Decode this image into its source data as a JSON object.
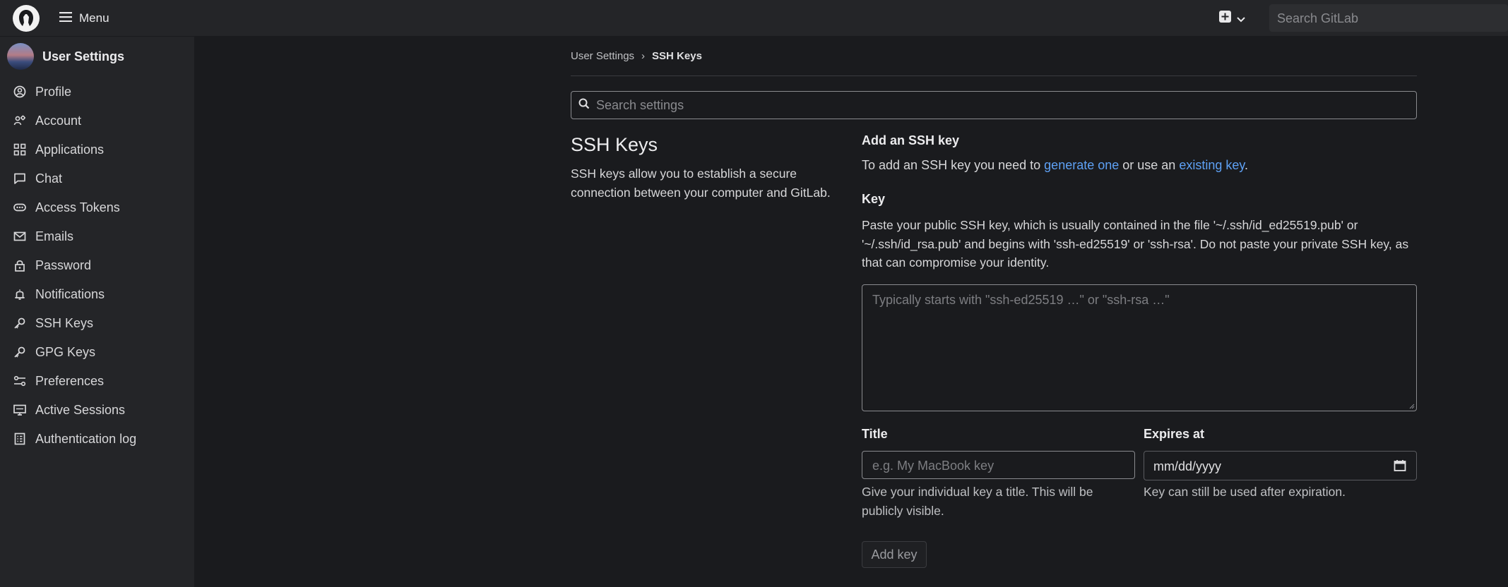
{
  "topbar": {
    "menu_label": "Menu",
    "search_placeholder": "Search GitLab"
  },
  "sidebar": {
    "title": "User Settings",
    "items": [
      {
        "label": "Profile",
        "icon": "profile-icon"
      },
      {
        "label": "Account",
        "icon": "account-icon"
      },
      {
        "label": "Applications",
        "icon": "applications-icon"
      },
      {
        "label": "Chat",
        "icon": "chat-icon"
      },
      {
        "label": "Access Tokens",
        "icon": "token-icon"
      },
      {
        "label": "Emails",
        "icon": "mail-icon"
      },
      {
        "label": "Password",
        "icon": "lock-icon"
      },
      {
        "label": "Notifications",
        "icon": "bell-icon"
      },
      {
        "label": "SSH Keys",
        "icon": "key-icon"
      },
      {
        "label": "GPG Keys",
        "icon": "key-icon"
      },
      {
        "label": "Preferences",
        "icon": "preferences-icon"
      },
      {
        "label": "Active Sessions",
        "icon": "monitor-icon"
      },
      {
        "label": "Authentication log",
        "icon": "log-icon"
      }
    ]
  },
  "breadcrumb": {
    "parent": "User Settings",
    "separator": "›",
    "current": "SSH Keys"
  },
  "settings_search": {
    "placeholder": "Search settings"
  },
  "section": {
    "title": "SSH Keys",
    "description": "SSH keys allow you to establish a secure connection between your computer and GitLab."
  },
  "form": {
    "add_title": "Add an SSH key",
    "add_help_prefix": "To add an SSH key you need to ",
    "generate_link": "generate one",
    "add_help_middle": " or use an ",
    "existing_link": "existing key",
    "add_help_suffix": ".",
    "key_label": "Key",
    "key_help": "Paste your public SSH key, which is usually contained in the file '~/.ssh/id_ed25519.pub' or '~/.ssh/id_rsa.pub' and begins with 'ssh-ed25519' or 'ssh-rsa'. Do not paste your private SSH key, as that can compromise your identity.",
    "key_placeholder": "Typically starts with \"ssh-ed25519 …\" or \"ssh-rsa …\"",
    "title_label": "Title",
    "title_placeholder": "e.g. My MacBook key",
    "title_help": "Give your individual key a title. This will be publicly visible.",
    "expires_label": "Expires at",
    "expires_value": "mm/dd/yyyy",
    "expires_help": "Key can still be used after expiration.",
    "add_button": "Add key"
  },
  "colors": {
    "background": "#1a1b1e",
    "sidebar": "#242528",
    "link": "#5ea1f5"
  }
}
